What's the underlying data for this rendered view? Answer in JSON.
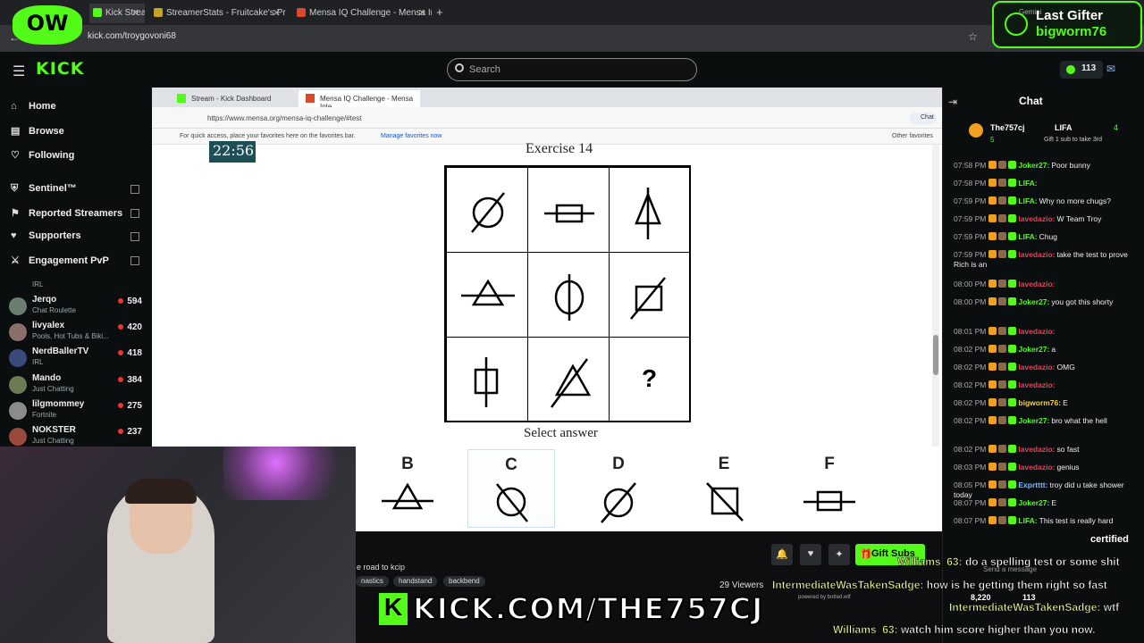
{
  "browser": {
    "tabs": [
      {
        "label": "Kick Stream - Watch Live",
        "favcolor": "#53fc18"
      },
      {
        "label": "StreamerStats - Fruitcake's Prof",
        "favcolor": "#c9a227"
      },
      {
        "label": "Mensa IQ Challenge - Mensa In",
        "favcolor": "#d9492b"
      }
    ],
    "url": "kick.com/troygovoni68"
  },
  "header": {
    "logo": "KICK",
    "search_placeholder": "Search",
    "coins": "113"
  },
  "sidebar": {
    "nav": [
      {
        "label": "Home",
        "icon": "home-icon",
        "glyph": "⌂"
      },
      {
        "label": "Browse",
        "icon": "browse-icon",
        "glyph": "▤"
      },
      {
        "label": "Following",
        "icon": "heart-icon",
        "glyph": "♡"
      },
      {
        "label": "Sentinel™",
        "icon": "shield-icon",
        "glyph": "⛨"
      },
      {
        "label": "Reported Streamers",
        "icon": "flag-icon",
        "glyph": "⚑"
      },
      {
        "label": "Supporters",
        "icon": "heart-icon",
        "glyph": "♥"
      },
      {
        "label": "Engagement PvP",
        "icon": "pvp-icon",
        "glyph": "⚔"
      }
    ],
    "irl_label": "IRL",
    "channels": [
      {
        "name": "Jerqo",
        "category": "Chat Roulette",
        "viewers": "594"
      },
      {
        "name": "livyalex",
        "category": "Pools, Hot Tubs & Biki...",
        "viewers": "420"
      },
      {
        "name": "NerdBallerTV",
        "category": "IRL",
        "viewers": "418"
      },
      {
        "name": "Mando",
        "category": "Just Chatting",
        "viewers": "384"
      },
      {
        "name": "lilgmommey",
        "category": "Fortnite",
        "viewers": "275"
      },
      {
        "name": "NOKSTER",
        "category": "Just Chatting",
        "viewers": "237"
      }
    ]
  },
  "inner_browser": {
    "tabs": [
      "Stream - Kick Dashboard",
      "Mensa IQ Challenge - Mensa Inte"
    ],
    "url": "https://www.mensa.org/mensa-iq-challenge/#test",
    "fav_text": "For quick access, place your favorites here on the favorites bar.",
    "fav_link": "Manage favorites now",
    "other_fav": "Other favorites",
    "chat_button": "Chat"
  },
  "test": {
    "timer": "22:56",
    "title": "Exercise 14",
    "question_mark": "?",
    "select_answer": "Select answer",
    "options": [
      "B",
      "C",
      "D",
      "E",
      "F"
    ]
  },
  "stream_info": {
    "title_fragment": "e road to kcip",
    "tags": [
      "nastics",
      "handstand",
      "backbend"
    ],
    "viewers": "29 Viewers",
    "gift_button": "Gift Subs",
    "send_message": "Send a message",
    "big_url": "KICK.COM/THE757CJ",
    "overlay_counts": [
      "8,220",
      "113"
    ]
  },
  "chat": {
    "title": "Chat",
    "pinned": {
      "user": "The757cj",
      "count": "5",
      "rival": "LIFA",
      "rival_count": "4",
      "sub": "Gift 1 sub to take 3rd"
    },
    "messages": [
      {
        "t": "07:58 PM",
        "u": "Joker27:",
        "c": "#53fc18",
        "m": "Poor bunny"
      },
      {
        "t": "07:58 PM",
        "u": "LIFA:",
        "c": "#53fc18",
        "m": ""
      },
      {
        "t": "07:59 PM",
        "u": "LIFA:",
        "c": "#53fc18",
        "m": "Why no more chugs?"
      },
      {
        "t": "07:59 PM",
        "u": "lavedazio:",
        "c": "#e0455a",
        "m": "W Team Troy"
      },
      {
        "t": "07:59 PM",
        "u": "LIFA:",
        "c": "#53fc18",
        "m": "Chug"
      },
      {
        "t": "07:59 PM",
        "u": "lavedazio:",
        "c": "#e0455a",
        "m": "take the test to prove Rich is an"
      },
      {
        "t": "08:00 PM",
        "u": "lavedazio:",
        "c": "#e0455a",
        "m": ""
      },
      {
        "t": "08:00 PM",
        "u": "Joker27:",
        "c": "#53fc18",
        "m": "you got this shorty"
      },
      {
        "t": "08:01 PM",
        "u": "lavedazio:",
        "c": "#e0455a",
        "m": ""
      },
      {
        "t": "08:02 PM",
        "u": "Joker27:",
        "c": "#53fc18",
        "m": "a"
      },
      {
        "t": "08:02 PM",
        "u": "lavedazio:",
        "c": "#e0455a",
        "m": "OMG"
      },
      {
        "t": "08:02 PM",
        "u": "lavedazio:",
        "c": "#e0455a",
        "m": ""
      },
      {
        "t": "08:02 PM",
        "u": "bigworm76:",
        "c": "#f0d04a",
        "m": "E"
      },
      {
        "t": "08:02 PM",
        "u": "Joker27:",
        "c": "#53fc18",
        "m": "bro what the hell"
      },
      {
        "t": "08:02 PM",
        "u": "lavedazio:",
        "c": "#e0455a",
        "m": "so fast"
      },
      {
        "t": "08:03 PM",
        "u": "lavedazio:",
        "c": "#e0455a",
        "m": "genius"
      },
      {
        "t": "08:05 PM",
        "u": "Exprtttt:",
        "c": "#7ab8ff",
        "m": "troy did u take shower today"
      },
      {
        "t": "08:07 PM",
        "u": "Joker27:",
        "c": "#53fc18",
        "m": "E"
      },
      {
        "t": "08:07 PM",
        "u": "LIFA:",
        "c": "#53fc18",
        "m": "This test is really hard"
      }
    ]
  },
  "overlay": {
    "last_gifter_title": "Last Gifter",
    "last_gifter_name": "bigworm76",
    "gemini_label": "Gemini",
    "corner_logo": "OW",
    "certified": "certified",
    "lines": [
      {
        "u": "Williams_63:",
        "m": "do a spelling test or some shit"
      },
      {
        "u": "IntermediateWasTakenSadge:",
        "m": "how is he getting them right so fast"
      },
      {
        "u": "IntermediateWasTakenSadge:",
        "m": "wtf"
      },
      {
        "u": "Williams_63:",
        "m": "watch him score higher than you now."
      }
    ],
    "powered": "powered by botted.wtf"
  }
}
